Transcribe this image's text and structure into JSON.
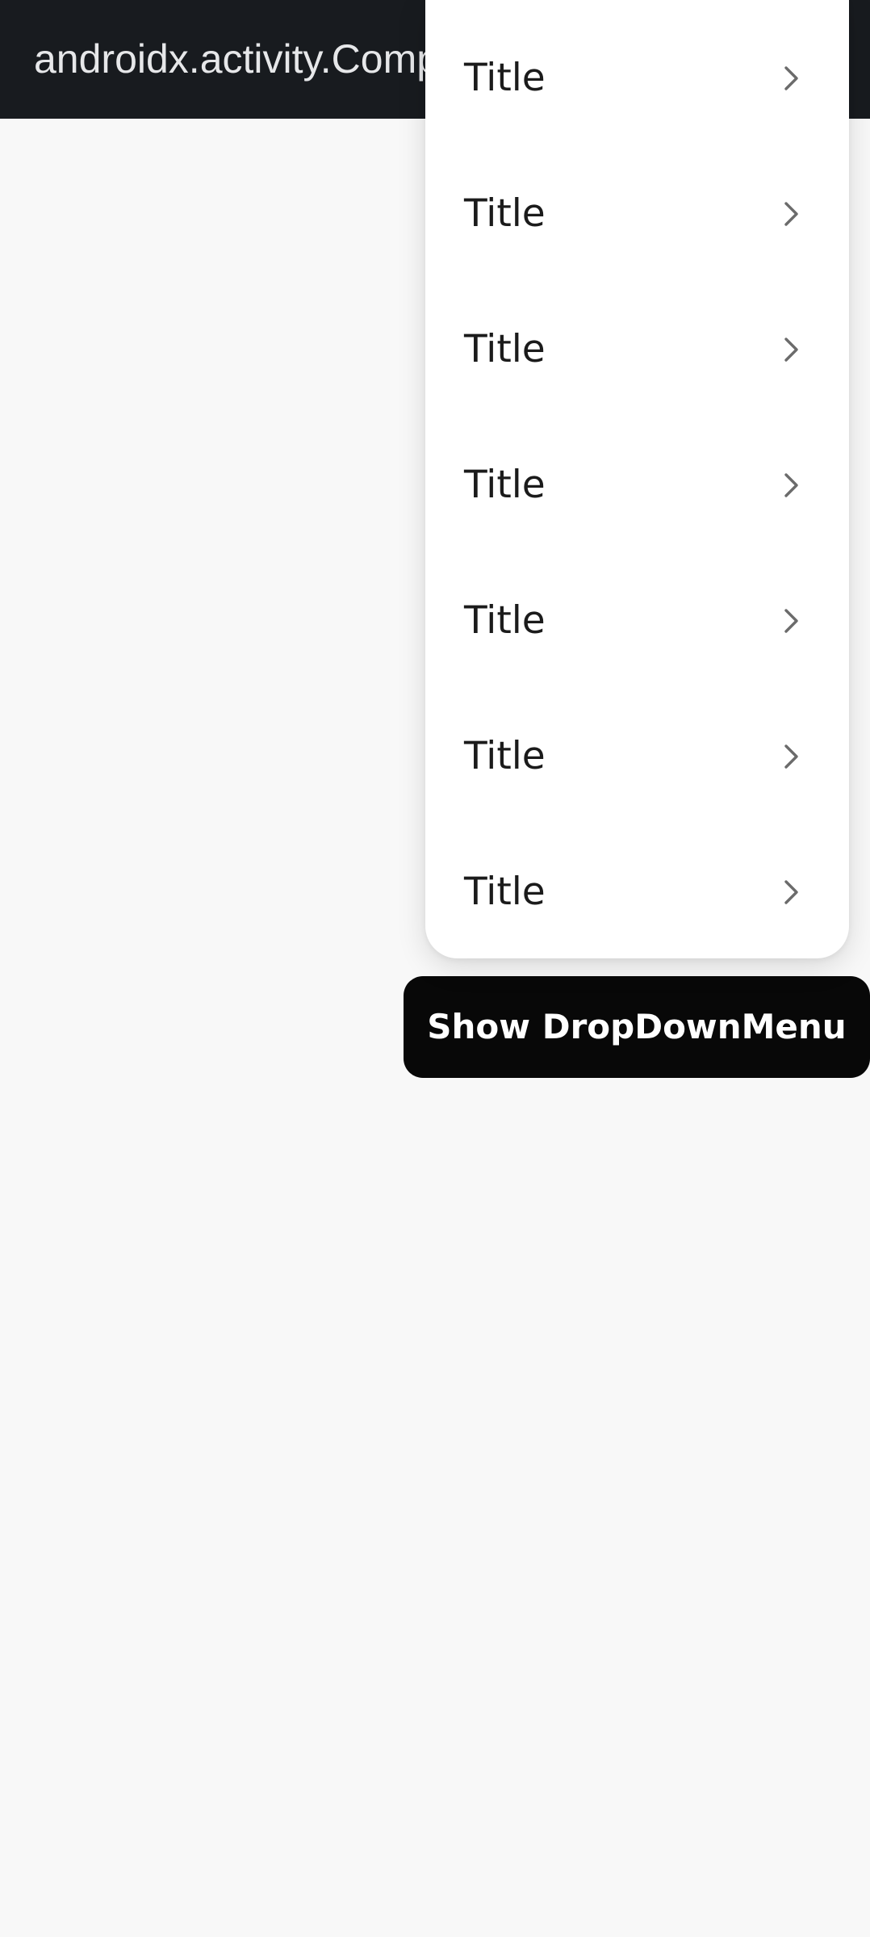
{
  "app_bar": {
    "title": "androidx.activity.ComponentActivity"
  },
  "dropdown_menu": {
    "items": [
      {
        "label": "Title",
        "icon": "chevron-right-icon"
      },
      {
        "label": "Title",
        "icon": "chevron-right-icon"
      },
      {
        "label": "Title",
        "icon": "chevron-right-icon"
      },
      {
        "label": "Title",
        "icon": "chevron-right-icon"
      },
      {
        "label": "Title",
        "icon": "chevron-right-icon"
      },
      {
        "label": "Title",
        "icon": "chevron-right-icon"
      },
      {
        "label": "Title",
        "icon": "chevron-right-icon"
      }
    ]
  },
  "show_button": {
    "label": "Show DropDownMenu"
  },
  "colors": {
    "app_bar_background": "#181b1f",
    "page_background": "#f8f8f8",
    "menu_background": "#ffffff",
    "button_background": "#080808",
    "button_text": "#ffffff",
    "chevron": "#6b6b6b"
  }
}
